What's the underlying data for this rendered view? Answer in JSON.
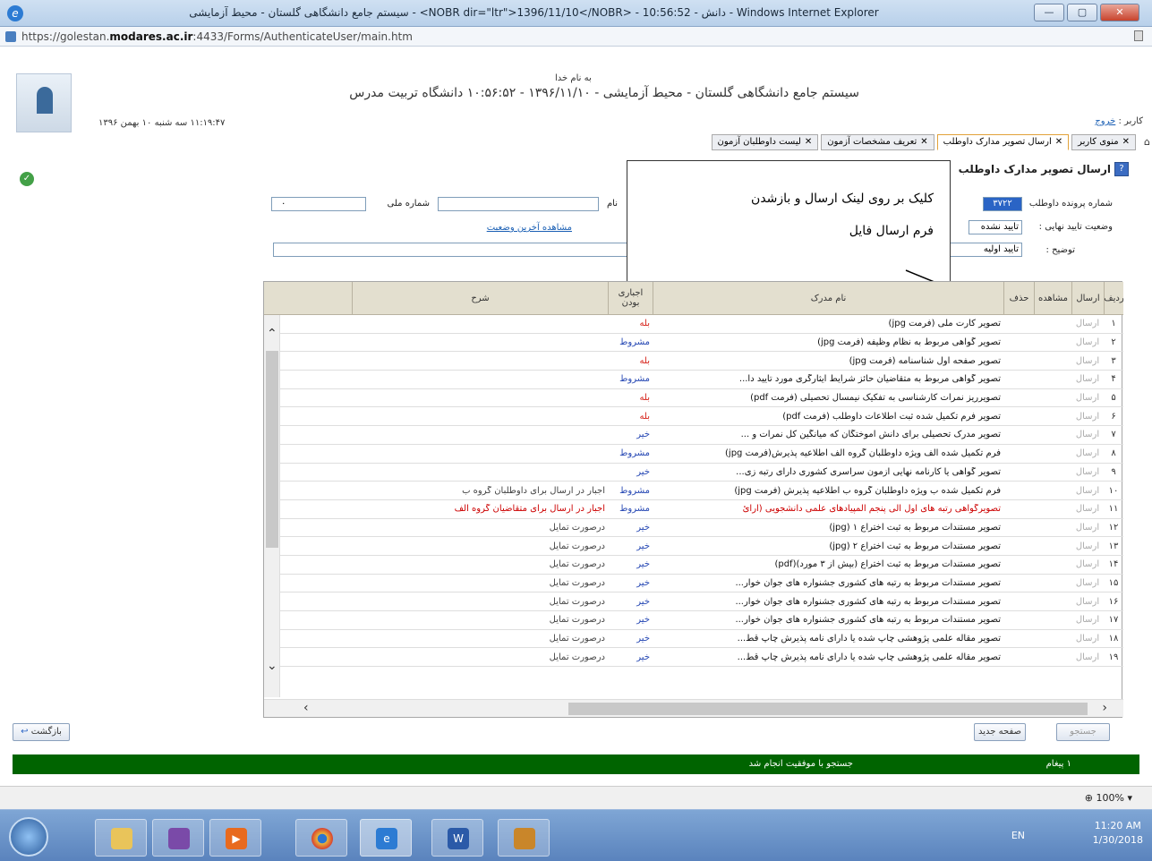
{
  "window": {
    "title": "سیستم جامع دانشگاهی گلستان - محیط آزمایشی - <NOBR dir=\"ltr\">1396/11/10</NOBR> - 10:56:52 - دانش - Windows Internet Explorer",
    "url_prefix": "https://golestan.",
    "url_domain": "modares.ac.ir",
    "url_suffix": ":4433/Forms/AuthenticateUser/main.htm"
  },
  "header": {
    "bismillah": "به نام خدا",
    "system_name": "سیستم جامع دانشگاهی گلستان - محیط آزمایشی - ۱۳۹۶/۱۱/۱۰ - ۱۰:۵۶:۵۲   دانشگاه تربیت مدرس",
    "datetime": "۱۱:۱۹:۴۷ سه شنبه ۱۰ بهمن ۱۳۹۶",
    "user_label": "کاربر :",
    "logout": "خروج"
  },
  "tabs": [
    {
      "label": "منوی کاربر",
      "active": false
    },
    {
      "label": "ارسال تصویر مدارک داوطلب",
      "active": true
    },
    {
      "label": "تعریف مشخصات آزمون",
      "active": false
    },
    {
      "label": "لیست داوطلبان آزمون",
      "active": false
    }
  ],
  "page": {
    "title": "ارسال تصویر مدارک داوطلب",
    "file_no_label": "شماره پرونده داوطلب",
    "file_no_value": "۳۷۲۲",
    "name_label": "نام",
    "national_id_label": "شماره ملی",
    "national_id_value": "۰",
    "final_status_label": "وضعیت تایید نهایی :",
    "final_status_value": "تایید نشده",
    "desc_label": "توضیح :",
    "desc_value": "تایید اولیه",
    "last_status_link": "مشاهده آخرین وضعیت"
  },
  "callout": {
    "line1": "کلیک بر روی لینک ارسال و بازشدن",
    "line2": "فرم ارسال فایل"
  },
  "table": {
    "headers": {
      "no": "ردیف",
      "send": "ارسال",
      "view": "مشاهده",
      "del": "حذف",
      "name": "نام مدرک",
      "req": "اجباری بودن",
      "desc": "شرح"
    },
    "rows": [
      {
        "no": "۱",
        "send": "ارسال",
        "name": "تصویر کارت ملی (فرمت jpg)",
        "req": "بله",
        "req_color": "red",
        "desc": ""
      },
      {
        "no": "۲",
        "send": "ارسال",
        "name": "تصویر گواهی مربوط به نظام وظیفه (فرمت jpg)",
        "req": "مشروط",
        "req_color": "blue",
        "desc": ""
      },
      {
        "no": "۳",
        "send": "ارسال",
        "name": "تصویر صفحه اول شناسنامه (فرمت jpg)",
        "req": "بله",
        "req_color": "red",
        "desc": ""
      },
      {
        "no": "۴",
        "send": "ارسال",
        "name": "تصویر گواهی مربوط به متقاضیان حائز شرایط ایثارگری مورد تایید دا...",
        "req": "مشروط",
        "req_color": "blue",
        "desc": ""
      },
      {
        "no": "۵",
        "send": "ارسال",
        "name": "تصویرریز نمرات کارشناسی به تفکیک نیمسال تحصیلی (فرمت pdf)",
        "req": "بله",
        "req_color": "red",
        "desc": ""
      },
      {
        "no": "۶",
        "send": "ارسال",
        "name": "تصویر فرم تکمیل شده ثبت اطلاعات داوطلب (فرمت pdf)",
        "req": "بله",
        "req_color": "red",
        "desc": ""
      },
      {
        "no": "۷",
        "send": "ارسال",
        "name": "تصویر مدرک تحصیلی برای دانش آموختگان که میانگین کل نمرات و ...",
        "req": "خیر",
        "req_color": "blue",
        "desc": ""
      },
      {
        "no": "۸",
        "send": "ارسال",
        "name": "فرم تکمیل شده الف ویژه داوطلبان گروه الف اطلاعیه پذیرش(فرمت jpg)",
        "req": "مشروط",
        "req_color": "blue",
        "desc": ""
      },
      {
        "no": "۹",
        "send": "ارسال",
        "name": "تصویر گواهی یا کارنامه نهایی آزمون سراسری کشوری دارای رتبه زی...",
        "req": "خیر",
        "req_color": "blue",
        "desc": ""
      },
      {
        "no": "۱۰",
        "send": "ارسال",
        "name": "فرم تکمیل شده ب ویژه داوطلبان گروه ب اطلاعیه پذیرش (فرمت jpg)",
        "req": "مشروط",
        "req_color": "blue",
        "desc": "اجبار در ارسال برای داوطلبان گروه ب"
      },
      {
        "no": "۱۱",
        "send": "ارسال",
        "name": "تصویرگواهی رتبه های اول الی پنجم المپیادهای علمی دانشجویی (ارائ",
        "req": "مشروط",
        "req_color": "blue",
        "desc": "اجبار در ارسال برای متقاضیان گروه الف",
        "highlight": true
      },
      {
        "no": "۱۲",
        "send": "ارسال",
        "name": "تصویر مستندات مربوط به  ثبت اختراع ۱ (jpg)",
        "req": "خیر",
        "req_color": "blue",
        "desc": "درصورت تمایل"
      },
      {
        "no": "۱۳",
        "send": "ارسال",
        "name": "تصویر مستندات مربوط به  ثبت اختراع ۲ (jpg)",
        "req": "خیر",
        "req_color": "blue",
        "desc": "درصورت تمایل"
      },
      {
        "no": "۱۴",
        "send": "ارسال",
        "name": "تصویر مستندات مربوط به  ثبت اختراع (بیش از ۳ مورد)(pdf)",
        "req": "خیر",
        "req_color": "blue",
        "desc": "درصورت تمایل"
      },
      {
        "no": "۱۵",
        "send": "ارسال",
        "name": "تصویر مستندات مربوط به  رتبه های کشوری جشنواره های جوان خوار...",
        "req": "خیر",
        "req_color": "blue",
        "desc": "درصورت تمایل"
      },
      {
        "no": "۱۶",
        "send": "ارسال",
        "name": "تصویر مستندات مربوط به  رتبه های کشوری جشنواره های جوان خوار...",
        "req": "خیر",
        "req_color": "blue",
        "desc": "درصورت تمایل"
      },
      {
        "no": "۱۷",
        "send": "ارسال",
        "name": "تصویر مستندات مربوط به  رتبه های کشوری جشنواره های جوان خوار...",
        "req": "خیر",
        "req_color": "blue",
        "desc": "درصورت تمایل"
      },
      {
        "no": "۱۸",
        "send": "ارسال",
        "name": "تصویر مقاله علمی پژوهشی  چاپ شده یا دارای نامه پذیرش چاپ قط...",
        "req": "خیر",
        "req_color": "blue",
        "desc": "درصورت تمایل"
      },
      {
        "no": "۱۹",
        "send": "ارسال",
        "name": "تصویر مقاله علمی پژوهشی  چاپ شده یا دارای نامه پذیرش چاپ قط...",
        "req": "خیر",
        "req_color": "blue",
        "desc": "درصورت تمایل"
      }
    ]
  },
  "buttons": {
    "back": "بازگشت",
    "search": "جستجو",
    "new_page": "صفحه جدید"
  },
  "status": {
    "message": "جستجو با موفقیت انجام شد",
    "count": "۱ پیغام"
  },
  "ie": {
    "zoom": "100%"
  },
  "taskbar": {
    "lang": "EN",
    "time": "11:20 AM",
    "date": "1/30/2018"
  }
}
